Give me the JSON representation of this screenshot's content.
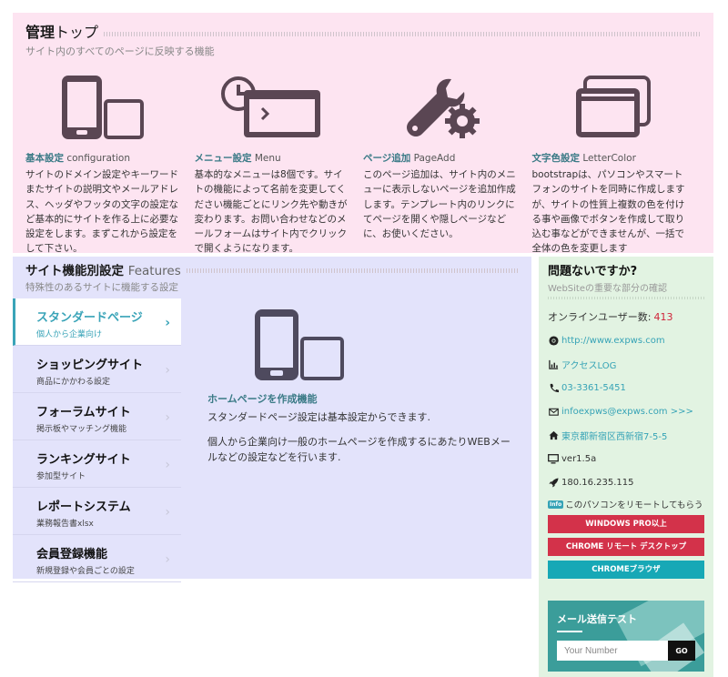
{
  "admin": {
    "title_bold": "管理",
    "title_light": "トップ",
    "subtitle": "サイト内のすべてのページに反映する機能",
    "features": [
      {
        "title_jp": "基本設定",
        "title_en": "configuration",
        "icon": "devices-icon",
        "desc": "サイトのドメイン設定やキーワードまたサイトの説明文やメールアドレス、ヘッダやフッタの文字の設定など基本的にサイトを作る上に必要な設定をします。まずこれから設定をして下さい。"
      },
      {
        "title_jp": "メニュー設定",
        "title_en": "Menu",
        "icon": "menu-window-clock-icon",
        "desc": "基本的なメニューは8個です。サイトの機能によって名前を変更してください機能ごとにリンク先や動きが変わります。お問い合わせなどのメールフォームはサイト内でクリックで開くようになります。"
      },
      {
        "title_jp": "ページ追加",
        "title_en": "PageAdd",
        "icon": "wrench-gear-icon",
        "desc": "このページ追加は、サイト内のメニューに表示しないページを追加作成します。テンプレート内のリンクにてページを開くや隠しページなどに、お使いください。"
      },
      {
        "title_jp": "文字色設定",
        "title_en": "LetterColor",
        "icon": "browser-windows-icon",
        "desc": "bootstrapは、パソコンやスマートフォンのサイトを同時に作成しますが、サイトの性質上複数の色を付ける事や画像でボタンを作成して取り込む事などができませんが、一括で全体の色を変更します"
      }
    ]
  },
  "site": {
    "title_bold": "サイト機能別設定",
    "title_en": "Features",
    "subtitle": "特殊性のあるサイトに機能する設定",
    "tabs": [
      {
        "name": "スタンダードページ",
        "sub": "個人から企業向け"
      },
      {
        "name": "ショッピングサイト",
        "sub": "商品にかかわる設定"
      },
      {
        "name": "フォーラムサイト",
        "sub": "掲示板やマッチング機能"
      },
      {
        "name": "ランキングサイト",
        "sub": "参加型サイト"
      },
      {
        "name": "レポートシステム",
        "sub": "業務報告書xlsx"
      },
      {
        "name": "会員登録機能",
        "sub": "新規登録や会員ごとの設定"
      }
    ],
    "content": {
      "title": "ホームページを作成機能",
      "line1": "スタンダードページ設定は基本設定からできます.",
      "line2": "個人から企業向け一般のホームページを作成するにあたりWEBメールなどの設定などを行います."
    }
  },
  "side": {
    "title": "問題ないですか?",
    "subtitle": "WebSiteの重要な部分の確認",
    "online_label": "オンラインユーザー数:",
    "online_count": "413",
    "url": "http://www.expws.com",
    "access": "アクセスLOG",
    "phone": "03-3361-5451",
    "email": "infoexpws@expws.com >>>",
    "address": "東京都新宿区西新宿7-5-5",
    "version": "ver1.5a",
    "ip": "180.16.235.115",
    "remote_badge": "Info",
    "remote_text": "このパソコンをリモートしてもらう",
    "buttons": [
      "WINDOWS PRO以上",
      "CHROME リモート デスクトップ",
      "CHROMEブラウザ"
    ],
    "mail": {
      "title": "メール送信テスト",
      "placeholder": "Your Number",
      "go": "GO"
    }
  },
  "colors": {
    "pink_bg": "#fde4f1",
    "purple_bg": "#e3e3fb",
    "green_bg": "#e2f3e2",
    "accent_teal": "#3aa4b8",
    "red_button": "#d3324a",
    "teal_button": "#17a8b6",
    "icon_dark": "#5a4653"
  }
}
